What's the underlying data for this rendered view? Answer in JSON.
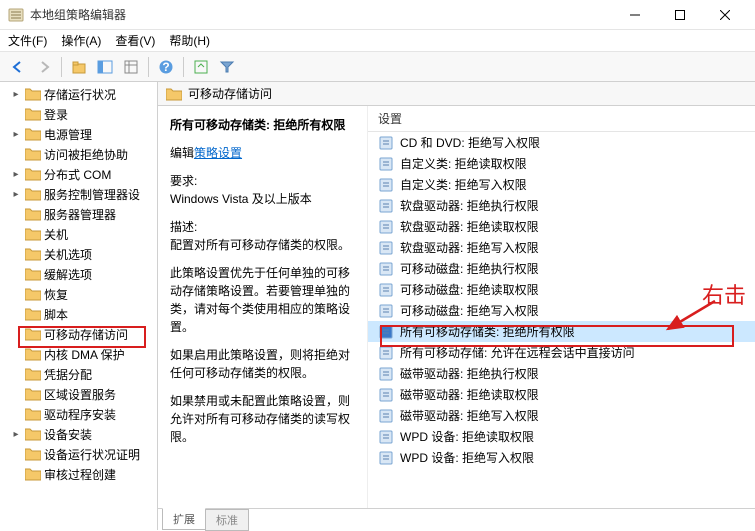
{
  "window": {
    "title": "本地组策略编辑器"
  },
  "menu": {
    "file": "文件(F)",
    "action": "操作(A)",
    "view": "查看(V)",
    "help": "帮助(H)"
  },
  "tree": {
    "items": [
      {
        "label": "存储运行状况",
        "exp": ">"
      },
      {
        "label": "登录",
        "exp": ""
      },
      {
        "label": "电源管理",
        "exp": ">"
      },
      {
        "label": "访问被拒绝协助",
        "exp": ""
      },
      {
        "label": "分布式 COM",
        "exp": ">"
      },
      {
        "label": "服务控制管理器设",
        "exp": ">"
      },
      {
        "label": "服务器管理器",
        "exp": ""
      },
      {
        "label": "关机",
        "exp": ""
      },
      {
        "label": "关机选项",
        "exp": ""
      },
      {
        "label": "缓解选项",
        "exp": ""
      },
      {
        "label": "恢复",
        "exp": ""
      },
      {
        "label": "脚本",
        "exp": ""
      },
      {
        "label": "可移动存储访问",
        "exp": "",
        "selected": true
      },
      {
        "label": "内核 DMA 保护",
        "exp": ""
      },
      {
        "label": "凭据分配",
        "exp": ""
      },
      {
        "label": "区域设置服务",
        "exp": ""
      },
      {
        "label": "驱动程序安装",
        "exp": ""
      },
      {
        "label": "设备安装",
        "exp": ">"
      },
      {
        "label": "设备运行状况证明",
        "exp": ""
      },
      {
        "label": "审核过程创建",
        "exp": ""
      }
    ]
  },
  "right": {
    "header": "可移动存储访问",
    "policyName": "所有可移动存储类: 拒绝所有权限",
    "editLabel": "编辑",
    "editLink": "策略设置",
    "reqLabel": "要求:",
    "reqValue": "Windows Vista 及以上版本",
    "descLabel": "描述:",
    "desc1": "配置对所有可移动存储类的权限。",
    "desc2": "此策略设置优先于任何单独的可移动存储策略设置。若要管理单独的类，请对每个类使用相应的策略设置。",
    "desc3": "如果启用此策略设置，则将拒绝对任何可移动存储类的权限。",
    "desc4": "如果禁用或未配置此策略设置，则允许对所有可移动存储类的读写权限。"
  },
  "settings": {
    "header": "设置",
    "items": [
      "CD 和 DVD: 拒绝写入权限",
      "自定义类: 拒绝读取权限",
      "自定义类: 拒绝写入权限",
      "软盘驱动器: 拒绝执行权限",
      "软盘驱动器: 拒绝读取权限",
      "软盘驱动器: 拒绝写入权限",
      "可移动磁盘: 拒绝执行权限",
      "可移动磁盘: 拒绝读取权限",
      "可移动磁盘: 拒绝写入权限",
      "所有可移动存储类: 拒绝所有权限",
      "所有可移动存储: 允许在远程会话中直接访问",
      "磁带驱动器: 拒绝执行权限",
      "磁带驱动器: 拒绝读取权限",
      "磁带驱动器: 拒绝写入权限",
      "WPD 设备: 拒绝读取权限",
      "WPD 设备: 拒绝写入权限"
    ],
    "selectedIndex": 9
  },
  "tabs": {
    "extended": "扩展",
    "standard": "标准"
  },
  "annotation": {
    "text": "右击"
  }
}
